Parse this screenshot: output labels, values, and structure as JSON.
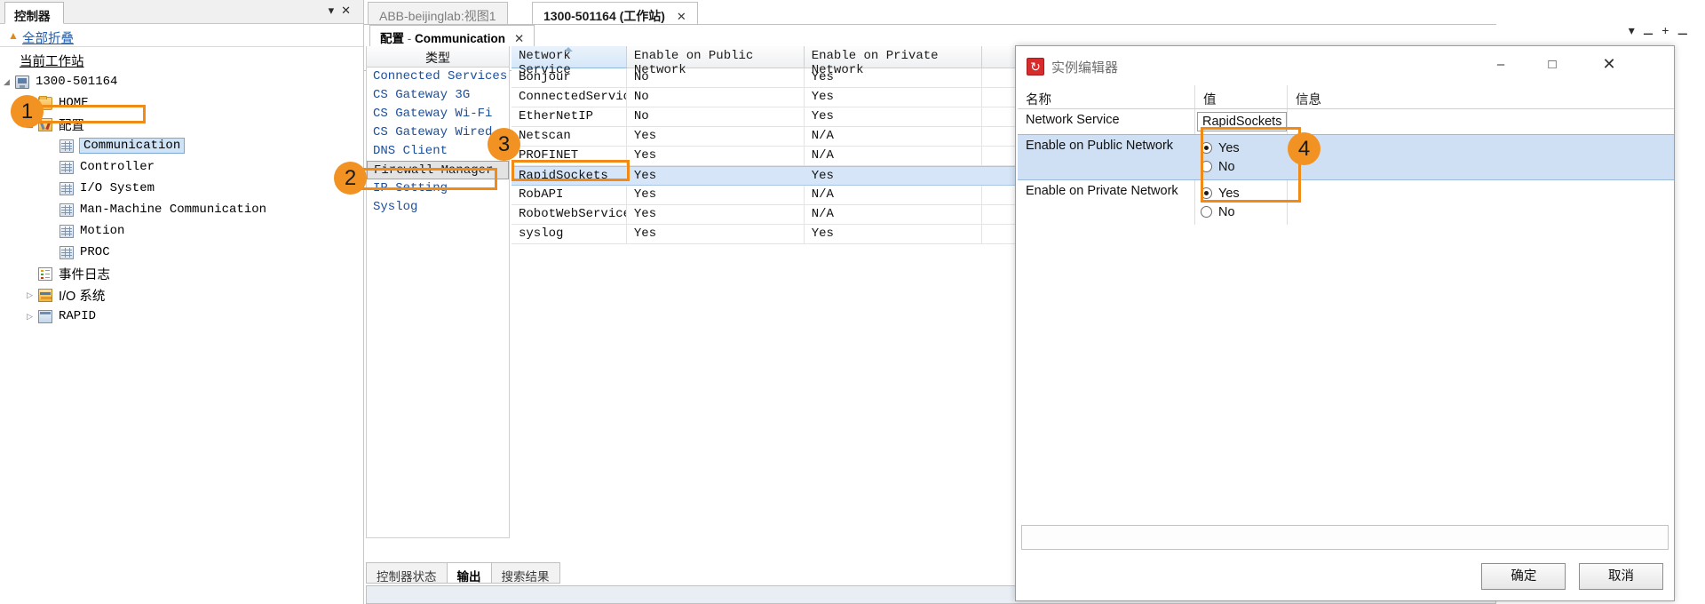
{
  "left_panel": {
    "tab_label": "控制器",
    "tab_menu_icon": "chevron-down-icon",
    "tab_close_icon": "close-icon",
    "collapse_all": "全部折叠",
    "root_label": "当前工作站",
    "tree": [
      {
        "label": "1300-501164",
        "icon": "controller-icon",
        "indent": 18,
        "expander": "◢",
        "cjk": false
      },
      {
        "label": "HOME",
        "icon": "folder-icon",
        "indent": 44,
        "expander": "▷",
        "cjk": false
      },
      {
        "label": "配置",
        "icon": "config-icon",
        "indent": 44,
        "expander": "◢",
        "cjk": true
      },
      {
        "label": "Communication",
        "icon": "table-icon",
        "indent": 68,
        "expander": "",
        "cjk": false,
        "selected": true
      },
      {
        "label": "Controller",
        "icon": "table-icon",
        "indent": 68,
        "expander": "",
        "cjk": false
      },
      {
        "label": "I/O System",
        "icon": "table-icon",
        "indent": 68,
        "expander": "",
        "cjk": false
      },
      {
        "label": "Man-Machine Communication",
        "icon": "table-icon",
        "indent": 68,
        "expander": "",
        "cjk": false
      },
      {
        "label": "Motion",
        "icon": "table-icon",
        "indent": 68,
        "expander": "",
        "cjk": false
      },
      {
        "label": "PROC",
        "icon": "table-icon",
        "indent": 68,
        "expander": "",
        "cjk": false
      },
      {
        "label": "事件日志",
        "icon": "event-log-icon",
        "indent": 44,
        "expander": "",
        "cjk": true
      },
      {
        "label": "I/O 系统",
        "icon": "io-system-icon",
        "indent": 44,
        "expander": "▷",
        "cjk": true
      },
      {
        "label": "RAPID",
        "icon": "rapid-icon",
        "indent": 44,
        "expander": "▷",
        "cjk": false
      }
    ]
  },
  "doc_tabs": [
    {
      "label": "ABB-beijinglab:视图1",
      "active": false,
      "closable": false
    },
    {
      "label": "1300-501164 (工作站)",
      "active": true,
      "closable": true
    }
  ],
  "inner_tab": {
    "prefix": "配置",
    "sep": " - ",
    "name": "Communication",
    "close_icon": "close-icon"
  },
  "window_controls": {
    "minimize": "–",
    "restore": "▫",
    "maximize": "+",
    "close": "–"
  },
  "type_panel": {
    "header": "类型",
    "items": [
      {
        "label": "Connected Services",
        "selected": false
      },
      {
        "label": "CS Gateway 3G",
        "selected": false
      },
      {
        "label": "CS Gateway Wi-Fi",
        "selected": false
      },
      {
        "label": "CS Gateway Wired",
        "selected": false
      },
      {
        "label": "DNS Client",
        "selected": false
      },
      {
        "label": "Firewall Manager",
        "selected": true
      },
      {
        "label": "IP Setting",
        "selected": false
      },
      {
        "label": "Syslog",
        "selected": false
      }
    ]
  },
  "grid": {
    "columns": [
      "Network Service",
      "Enable on Public Network",
      "Enable on Private Network",
      ""
    ],
    "sorted_column": "Network Service",
    "rows": [
      {
        "service": "Bonjour",
        "public": "No",
        "private": "Yes",
        "selected": false
      },
      {
        "service": "ConnectedServices",
        "public": "No",
        "private": "Yes",
        "selected": false
      },
      {
        "service": "EtherNetIP",
        "public": "No",
        "private": "Yes",
        "selected": false
      },
      {
        "service": "Netscan",
        "public": "Yes",
        "private": "N/A",
        "selected": false
      },
      {
        "service": "PROFINET",
        "public": "Yes",
        "private": "N/A",
        "selected": false
      },
      {
        "service": "RapidSockets",
        "public": "Yes",
        "private": "Yes",
        "selected": true
      },
      {
        "service": "RobAPI",
        "public": "Yes",
        "private": "N/A",
        "selected": false
      },
      {
        "service": "RobotWebServices",
        "public": "Yes",
        "private": "N/A",
        "selected": false
      },
      {
        "service": "syslog",
        "public": "Yes",
        "private": "Yes",
        "selected": false
      }
    ]
  },
  "bottom_tabs": [
    {
      "label": "控制器状态",
      "active": false
    },
    {
      "label": "输出",
      "active": true
    },
    {
      "label": "搜索结果",
      "active": false
    }
  ],
  "dialog": {
    "icon": "instance-editor-icon",
    "title": "实例编辑器",
    "minimize_icon": "minimize-icon",
    "maximize_icon": "maximize-icon",
    "close_icon": "close-icon",
    "columns": [
      "名称",
      "值",
      "信息"
    ],
    "rows": [
      {
        "name": "Network Service",
        "kind": "text",
        "value": "RapidSockets",
        "selected": false
      },
      {
        "name": "Enable on Public Network",
        "kind": "radio",
        "options": [
          {
            "label": "Yes",
            "checked": true
          },
          {
            "label": "No",
            "checked": false
          }
        ],
        "selected": true
      },
      {
        "name": "Enable on Private Network",
        "kind": "radio",
        "options": [
          {
            "label": "Yes",
            "checked": true
          },
          {
            "label": "No",
            "checked": false
          }
        ],
        "selected": false
      }
    ],
    "ok_label": "确定",
    "cancel_label": "取消"
  },
  "annotations": [
    {
      "number": "1",
      "target": "tree-item-communication"
    },
    {
      "number": "2",
      "target": "type-item-firewall-manager"
    },
    {
      "number": "3",
      "target": "grid-row-rapidsockets"
    },
    {
      "number": "4",
      "target": "dialog-public-network-radios"
    }
  ],
  "colors": {
    "annotation_orange": "#f29222",
    "highlight_border": "#ef8b16",
    "selection_blue": "#d6e6f8",
    "link_blue": "#1e5fb4",
    "type_text_blue": "#1b4f9c"
  }
}
